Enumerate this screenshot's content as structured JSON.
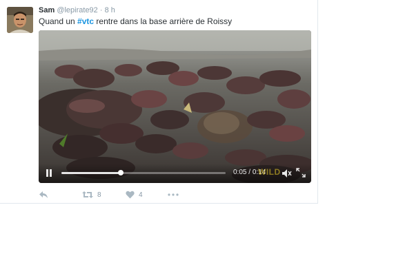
{
  "tweet": {
    "author_name": "Sam",
    "author_handle": "@lepirate92",
    "separator": "·",
    "timestamp": "8 h",
    "text_before": "Quand un ",
    "hashtag": "#vtc",
    "text_after": " rentre dans la base arrière de Roissy"
  },
  "video": {
    "current_time": "0:05",
    "duration": "0:14",
    "time_separator": "/",
    "progress": 0.36,
    "watermark": "WILD"
  },
  "actions": {
    "reply": {
      "icon": "reply-icon"
    },
    "retweet": {
      "icon": "retweet-icon",
      "count": "8"
    },
    "like": {
      "icon": "heart-icon",
      "count": "4"
    },
    "more": {
      "icon": "more-dots-icon"
    }
  },
  "colors": {
    "link": "#1b95e0",
    "muted": "#8899a6",
    "text": "#292f33"
  }
}
